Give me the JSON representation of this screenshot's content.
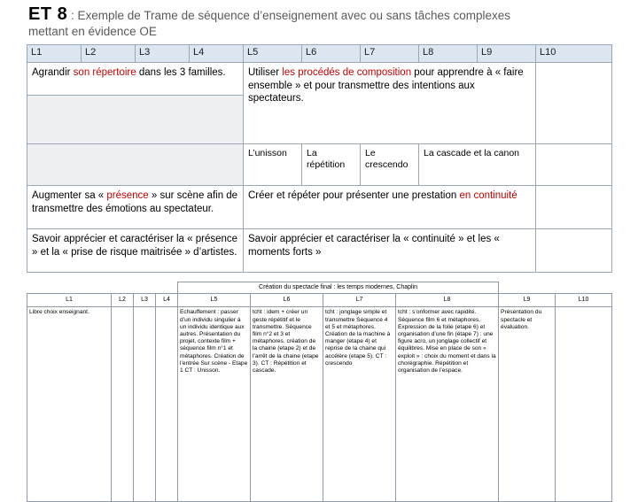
{
  "title": {
    "code": "ET 8",
    "colon": " : ",
    "rest": "Exemple de Trame de séquence d’enseignement avec ou sans tâches complexes",
    "second_line": "mettant en évidence OE"
  },
  "main_table": {
    "headers": [
      "L1",
      "L2",
      "L3",
      "L4",
      "L5",
      "L6",
      "L7",
      "L8",
      "L9",
      "L10"
    ],
    "row1": {
      "left_pre": "Agrandir ",
      "left_red": "son répertoire",
      "left_post": " dans les 3 familles.",
      "right_pre": "Utiliser ",
      "right_red": "les procédés de composition",
      "right_post": " pour apprendre à « faire ensemble » et pour transmettre des intentions aux spectateurs."
    },
    "row2": {
      "c1": "L’unisson",
      "c2": "La répétition",
      "c3": "Le crescendo",
      "c4": "La cascade et la canon"
    },
    "row3": {
      "left_pre": "Augmenter sa « ",
      "left_red": "présence",
      "left_post": " » sur scène afin de transmettre des émotions au spectateur.",
      "right_pre": "Créer et répéter pour présenter une prestation ",
      "right_red": "en continuité"
    },
    "row4": {
      "left": "Savoir apprécier et caractériser la « présence » et la « prise de risque maitrisée » d’artistes.",
      "right": "Savoir apprécier et caractériser la « continuité » et les « moments forts »"
    }
  },
  "plan_table": {
    "banner": "Création du spectacle final : les temps modernes, Chaplin",
    "headers": {
      "l1": "L1",
      "l2": "L2",
      "l3": "L3",
      "l4": "L4",
      "l5": "L5",
      "l6": "L6",
      "l7": "L7",
      "l8": "L8",
      "l9": "L9",
      "l10": "L10"
    },
    "cells": {
      "l1": "Libre choix enseignant.",
      "l2": "",
      "l3": "",
      "l4": "",
      "l5": "Echauffement : passer d’un individu singulier à un individu identique aux autres. Présentation du projet, contexte film + séquence film n°1 et métaphores. Création de l’entrée Sur scène - Etape 1 CT : Unisson.",
      "l6": "tcht : idem + créer un geste répétitif et le transmettre. Séquence film n°2 et 3 et métaphores. création de la chaine (etape 2) et de l’arrêt de la chaine (etape 3). CT : Répétition et cascade.",
      "l7": "tcht : jonglage simple et transmettre Séquence 4 et 5 et métaphores. Création de la machine à manger (etape 4) et reprise de la chaine qui accélère (etape 5). CT : crescendo",
      "l8": "tcht : s’onformer avec rapidité. Séquence film 6 et métaphores. Expression de la folie (etape 6) et organisation d’une fin (étape 7) : une figure acro, un jonglage collectif et équilibres. Mise en place de son « exploit » : choix du moment et dans la chorégraphie. Répétition et organisation de l’espace.",
      "l9": "Présentation du spectacle et évaluation.",
      "l10": ""
    }
  }
}
